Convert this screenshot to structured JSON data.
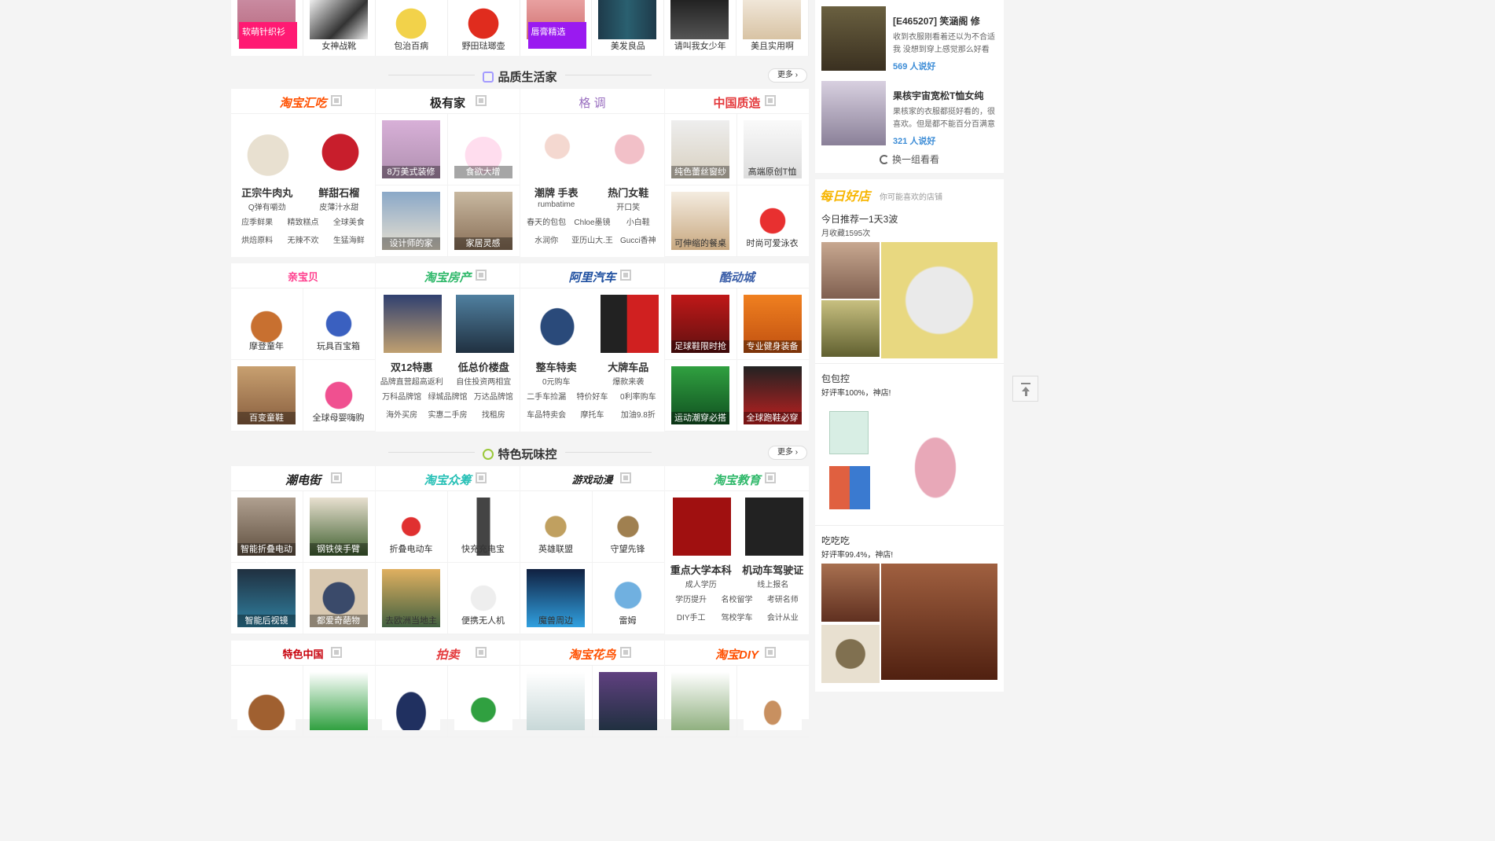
{
  "top_strip": [
    {
      "label": "软萌针织衫",
      "overlay": true,
      "color": "#ff1a73"
    },
    {
      "label": "女神战靴"
    },
    {
      "label": "包治百病"
    },
    {
      "label": "野田琺瑯壶"
    },
    {
      "label": "唇膏精选",
      "overlay": true,
      "color": "#9a1af0"
    },
    {
      "label": "美发良品"
    },
    {
      "label": "请叫我女少年"
    },
    {
      "label": "美且实用啊"
    }
  ],
  "section1": {
    "title": "品质生活家",
    "more": "更多"
  },
  "section2": {
    "title": "特色玩味控",
    "more": "更多"
  },
  "blocks_row1": [
    {
      "brand": "淘宝汇吃",
      "brand_color": "#ff5000",
      "type": "big",
      "items": [
        {
          "name": "正宗牛肉丸",
          "sub": "Q弹有嚼劲"
        },
        {
          "name": "鲜甜石榴",
          "sub": "皮薄汁水甜"
        }
      ],
      "links": [
        "应季鲜果",
        "精致糕点",
        "全球美食",
        "烘焙原料",
        "无辣不欢",
        "生猛海鲜"
      ]
    },
    {
      "brand": "极有家",
      "brand_color": "#222",
      "type": "cells",
      "cells": [
        "8万美式装修",
        "食欲大增",
        "设计师的家",
        "家居灵感"
      ]
    },
    {
      "brand": "格 调",
      "brand_color": "#9a6fc0",
      "type": "big",
      "items": [
        {
          "name": "潮牌 手表",
          "sub": "rumbatime"
        },
        {
          "name": "热门女鞋",
          "sub": "开口笑"
        }
      ],
      "links": [
        "春天的包包",
        "Chloe墨镜",
        "小白鞋",
        "水润你",
        "亚历山大.王",
        "Gucci香神"
      ]
    },
    {
      "brand": "中国质造",
      "brand_color": "#e4393c",
      "type": "cells",
      "cells": [
        "纯色蕾丝窗纱",
        "高端原创T恤",
        "可伸缩的餐桌",
        "时尚可爱泳衣"
      ]
    }
  ],
  "blocks_row2": [
    {
      "brand": "亲宝贝",
      "brand_color": "#ff3c8c",
      "type": "cells",
      "cells": [
        "摩登童年",
        "玩具百宝箱",
        "百变童鞋",
        "全球母婴嗨购"
      ]
    },
    {
      "brand": "淘宝房产",
      "brand_color": "#2fb86a",
      "type": "big",
      "items": [
        {
          "name": "双12特惠",
          "sub": "品牌直营超高返利"
        },
        {
          "name": "低总价楼盘",
          "sub": "自住投资两相宜"
        }
      ],
      "links": [
        "万科品牌馆",
        "绿城品牌馆",
        "万达品牌馆",
        "海外买房",
        "实惠二手房",
        "找租房"
      ]
    },
    {
      "brand": "阿里汽车",
      "brand_color": "#1e4fa0",
      "type": "big",
      "items": [
        {
          "name": "整车特卖",
          "sub": "0元购车"
        },
        {
          "name": "大牌车品",
          "sub": "爆款来袭"
        }
      ],
      "links": [
        "二手车捡漏",
        "特价好车",
        "0利率购车",
        "车品特卖会",
        "摩托车",
        "加油9.8折"
      ]
    },
    {
      "brand": "酷动城",
      "brand_color": "#3a5ea8",
      "type": "cells",
      "cells": [
        "足球鞋限时抢",
        "专业健身装备",
        "运动潮穿必搭",
        "全球跑鞋必穿"
      ]
    }
  ],
  "blocks_row3": [
    {
      "brand": "潮电街",
      "brand_color": "#222",
      "type": "cells",
      "cells": [
        "智能折叠电动车",
        "钢铁侠手臂",
        "智能后视镜",
        "都爱奇葩物"
      ]
    },
    {
      "brand": "淘宝众筹",
      "brand_color": "#27c0b6",
      "type": "cells",
      "cells": [
        "折叠电动车",
        "快充充电宝",
        "去欧洲当地主",
        "便携无人机"
      ]
    },
    {
      "brand": "游戏动漫",
      "brand_color": "#222",
      "type": "cells",
      "cells": [
        "英雄联盟",
        "守望先锋",
        "魔兽周边",
        "雷姆"
      ]
    },
    {
      "brand": "淘宝教育",
      "brand_color": "#2fb86a",
      "type": "big",
      "items": [
        {
          "name": "重点大学本科",
          "sub": "成人学历"
        },
        {
          "name": "机动车驾驶证",
          "sub": "线上报名"
        }
      ],
      "links": [
        "学历提升",
        "名校留学",
        "考研名师",
        "DIY手工",
        "驾校学车",
        "会计从业"
      ]
    }
  ],
  "blocks_row4": [
    {
      "brand": "特色中国",
      "brand_color": "#c7000b"
    },
    {
      "brand": "拍卖",
      "brand_color": "#e4393c"
    },
    {
      "brand": "淘宝花鸟",
      "brand_color": "#ff5000"
    },
    {
      "brand": "淘宝DIY",
      "brand_color": "#ff5000"
    }
  ],
  "side": {
    "posts": [
      {
        "title": "[E465207] 笑涵阁 修",
        "desc": "收到衣服刚看着还以为不合适 我 没想到穿上感觉那么好看",
        "count": "569 人说好"
      },
      {
        "title": "果核宇宙宽松T恤女纯",
        "desc": "果核家的衣服都挺好看的，很喜欢。但是都不能百分百满意",
        "count": "321 人说好"
      }
    ],
    "refresh": "换一组看看",
    "daily": {
      "logo": "每日好店",
      "slogan": "你可能喜欢的店铺",
      "headline": "今日推荐一1天3波",
      "fans": "月收藏1595次"
    },
    "shops": [
      {
        "name": "包包控",
        "rating": "好评率100%，神店!"
      },
      {
        "name": "吃吃吃",
        "rating": "好评率99.4%，神店!"
      }
    ]
  }
}
